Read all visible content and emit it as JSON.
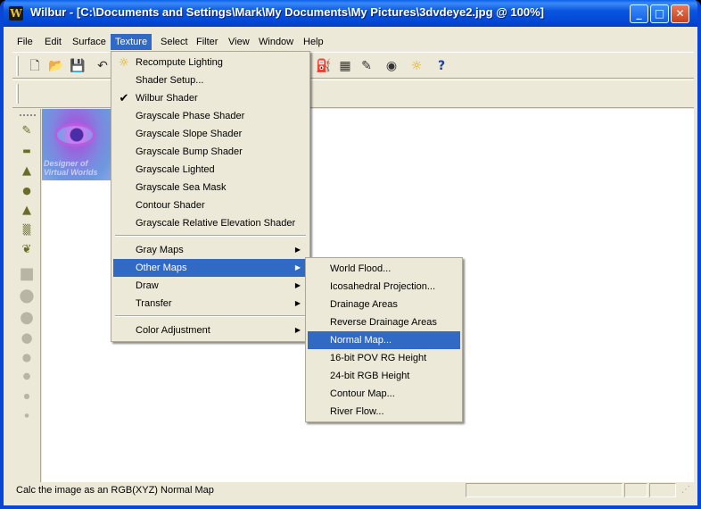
{
  "window": {
    "app_icon": "W",
    "title": "Wilbur - [C:\\Documents and Settings\\Mark\\My Documents\\My Pictures\\3dvdeye2.jpg @ 100%]",
    "caption_min": "_",
    "caption_max": "□",
    "caption_close": "✕"
  },
  "menubar": [
    {
      "label": "File"
    },
    {
      "label": "Edit"
    },
    {
      "label": "Surface"
    },
    {
      "label": "Texture"
    },
    {
      "label": "Select"
    },
    {
      "label": "Filter"
    },
    {
      "label": "View"
    },
    {
      "label": "Window"
    },
    {
      "label": "Help"
    }
  ],
  "toolbar": {
    "new_icon": "🗋",
    "open_icon": "📂",
    "save_icon": "💾",
    "undo_icon": "↶",
    "fill_icon": "⛽",
    "gradient_icon": "▦",
    "pencil_icon": "✎",
    "globe_icon": "◉",
    "light_icon": "☼",
    "help_icon": "?"
  },
  "tools": {
    "brush": "✎",
    "valley": "▬",
    "hill": "▲",
    "drop": "●",
    "cone": "▲",
    "noise": "▒",
    "leaf": "❦",
    "square": "■",
    "circle_lg": "●",
    "circle_1": "●",
    "circle_2": "●",
    "circle_3": "●",
    "circle_4": "●",
    "circle_5": "●",
    "circle_6": "●"
  },
  "thumbnail": {
    "caption_line1": "Designer of",
    "caption_line2": "Virtual Worlds"
  },
  "texture_menu": {
    "items": [
      {
        "label": "Recompute Lighting",
        "icon": "☼"
      },
      {
        "label": "Shader Setup..."
      },
      {
        "label": "Wilbur Shader",
        "check": "✔"
      },
      {
        "label": "Grayscale Phase Shader"
      },
      {
        "label": "Grayscale Slope Shader"
      },
      {
        "label": "Grayscale Bump Shader"
      },
      {
        "label": "Grayscale Lighted"
      },
      {
        "label": "Grayscale Sea Mask"
      },
      {
        "label": "Contour Shader"
      },
      {
        "label": "Grayscale Relative Elevation Shader"
      },
      {
        "label": "Gray Maps",
        "arrow": "▶"
      },
      {
        "label": "Other Maps",
        "arrow": "▶"
      },
      {
        "label": "Draw",
        "arrow": "▶"
      },
      {
        "label": "Transfer",
        "arrow": "▶"
      },
      {
        "label": "Color Adjustment",
        "arrow": "▶"
      }
    ]
  },
  "other_maps_submenu": {
    "items": [
      {
        "label": "World Flood..."
      },
      {
        "label": "Icosahedral Projection..."
      },
      {
        "label": "Drainage Areas"
      },
      {
        "label": "Reverse Drainage Areas"
      },
      {
        "label": "Normal Map..."
      },
      {
        "label": "16-bit POV RG Height"
      },
      {
        "label": "24-bit RGB Height"
      },
      {
        "label": "Contour Map..."
      },
      {
        "label": "River Flow..."
      }
    ]
  },
  "statusbar": {
    "text": "Calc the image as an RGB(XYZ) Normal Map",
    "grip": "⋰"
  }
}
